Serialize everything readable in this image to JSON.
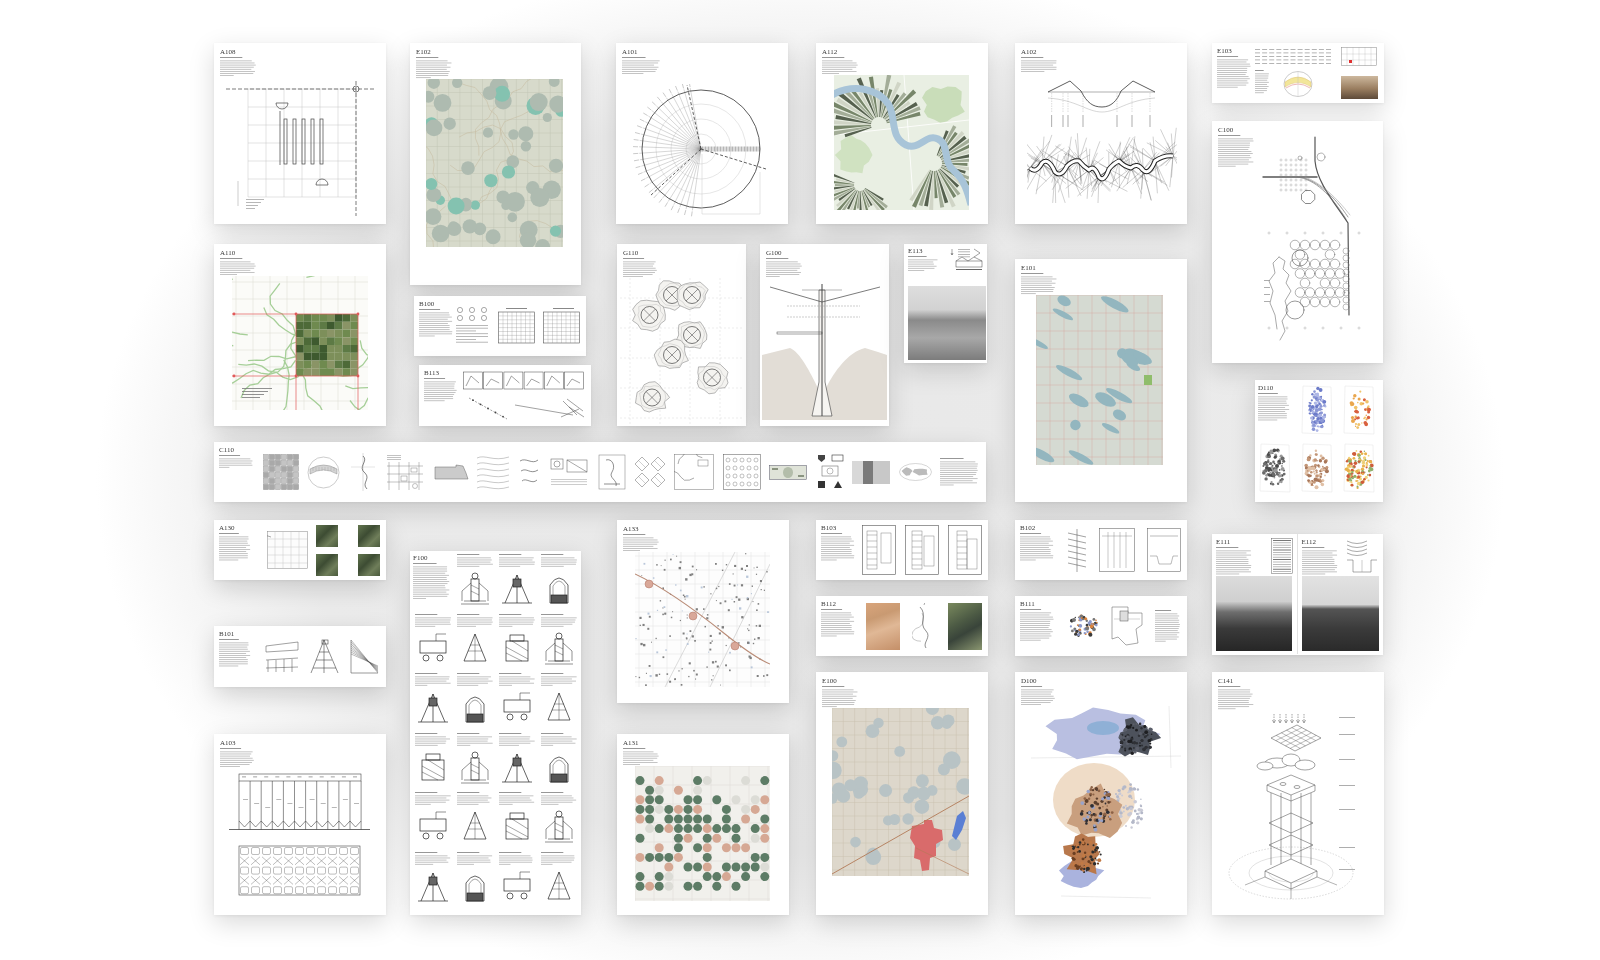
{
  "sheets": [
    {
      "code": "A108",
      "kind": "grid-plan"
    },
    {
      "code": "A110",
      "kind": "aerial-map"
    },
    {
      "code": "E102",
      "kind": "topo-map"
    },
    {
      "code": "B100",
      "kind": "table-sheet"
    },
    {
      "code": "B113",
      "kind": "detail-row"
    },
    {
      "code": "A101",
      "kind": "polar-diagram"
    },
    {
      "code": "A112",
      "kind": "river-map"
    },
    {
      "code": "G110",
      "kind": "cluster-plan"
    },
    {
      "code": "G100",
      "kind": "tower-section"
    },
    {
      "code": "E113",
      "kind": "photo-sheet"
    },
    {
      "code": "C110",
      "kind": "catalog-strip"
    },
    {
      "code": "A130",
      "kind": "aerial-tiles"
    },
    {
      "code": "B101",
      "kind": "sketch-row"
    },
    {
      "code": "A103",
      "kind": "silo-section"
    },
    {
      "code": "F100",
      "kind": "patent-grid"
    },
    {
      "code": "A133",
      "kind": "dot-map"
    },
    {
      "code": "A131",
      "kind": "pivot-map"
    },
    {
      "code": "B103",
      "kind": "plan-row"
    },
    {
      "code": "B112",
      "kind": "map-row"
    },
    {
      "code": "E100",
      "kind": "town-map"
    },
    {
      "code": "A102",
      "kind": "valley-section"
    },
    {
      "code": "E101",
      "kind": "lake-map"
    },
    {
      "code": "B102",
      "kind": "section-row"
    },
    {
      "code": "B111",
      "kind": "diagram-row"
    },
    {
      "code": "D100",
      "kind": "watershed"
    },
    {
      "code": "E103",
      "kind": "data-sheet"
    },
    {
      "code": "C100",
      "kind": "site-plan"
    },
    {
      "code": "D110",
      "kind": "density-maps"
    },
    {
      "codes": [
        "E111",
        "E112"
      ],
      "kind": "photo-pair"
    },
    {
      "code": "C141",
      "kind": "axonometric"
    }
  ]
}
